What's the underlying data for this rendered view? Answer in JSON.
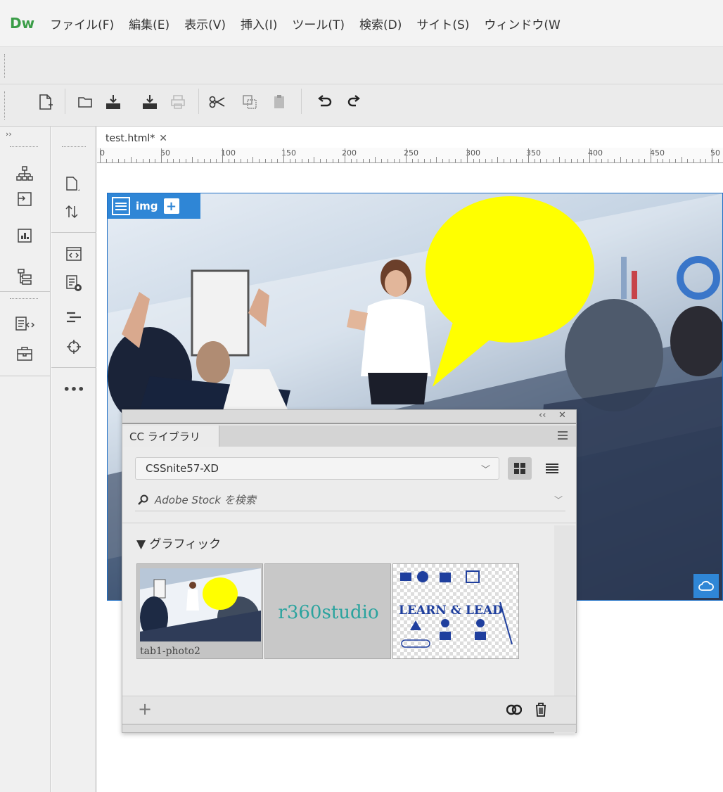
{
  "app": {
    "logo": "Dw",
    "menu": [
      "ファイル(F)",
      "編集(E)",
      "表示(V)",
      "挿入(I)",
      "ツール(T)",
      "検索(D)",
      "サイト(S)",
      "ウィンドウ(W"
    ]
  },
  "toolbar_icons": [
    "new-file-icon",
    "open-folder-icon",
    "save-icon",
    "save-all-icon",
    "print-icon",
    "cut-icon",
    "copy-icon",
    "paste-icon",
    "undo-icon",
    "redo-icon"
  ],
  "document": {
    "tab_label": "test.html*",
    "ruler_labels": [
      "0",
      "50",
      "100",
      "150",
      "200",
      "250",
      "300",
      "350",
      "400",
      "450",
      "50"
    ]
  },
  "element_tag": {
    "label": "img",
    "add_symbol": "+"
  },
  "more_label": "•••",
  "cc_panel": {
    "tab_label": "CC ライブラリ",
    "collapse": "‹‹",
    "close": "✕",
    "library_name": "CSSnite57-XD",
    "search_placeholder": "Adobe Stock を検索",
    "section_title": "▼ グラフィック",
    "items": [
      {
        "label": "tab1-photo2"
      },
      {
        "label": "r360studio"
      },
      {
        "label": "LEARN & LEAD"
      }
    ],
    "add_label": "+"
  },
  "colors": {
    "accent": "#2f86d6",
    "dw_green": "#3a9d47",
    "speech_bubble": "#ffff00",
    "r360_teal": "#2aa39e",
    "learn_blue": "#1f3f9e"
  }
}
